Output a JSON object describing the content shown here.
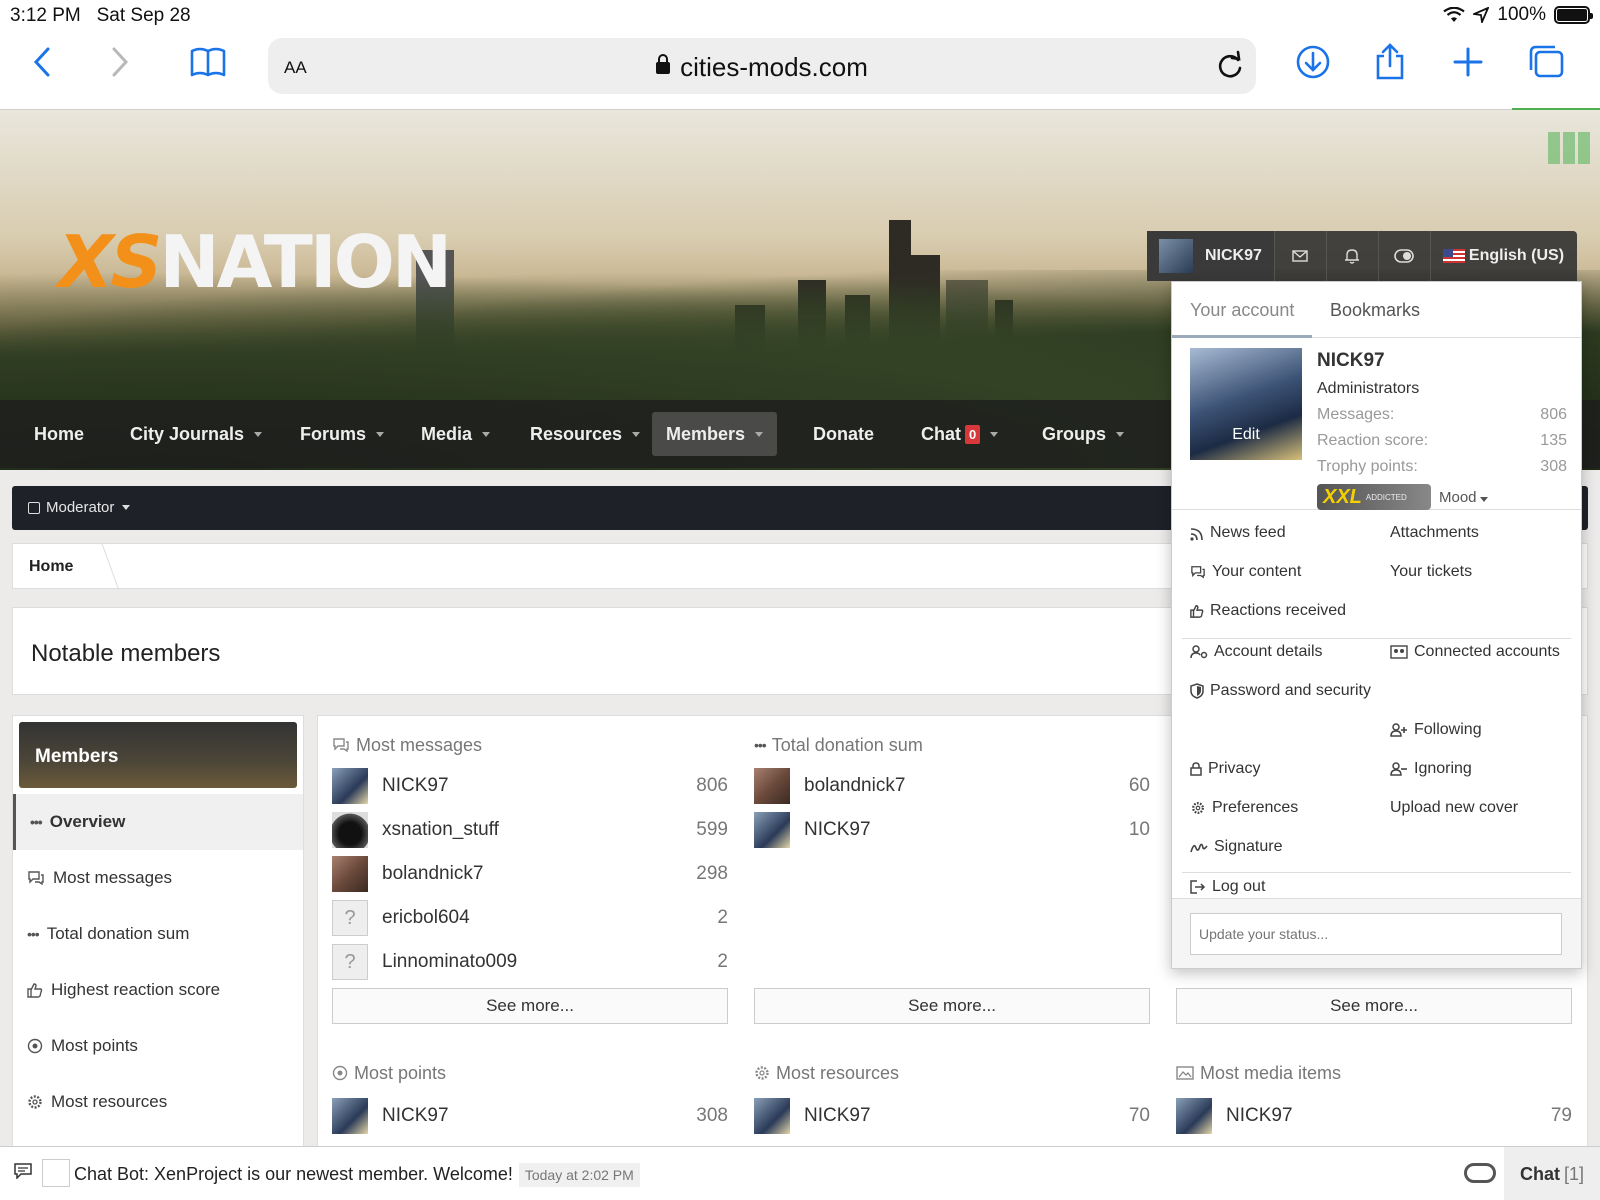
{
  "status": {
    "time": "3:12 PM",
    "date": "Sat Sep 28",
    "battery": "100%"
  },
  "browser": {
    "text_size": "AA",
    "url": "cities-mods.com"
  },
  "site": {
    "logo_xs": "XS",
    "logo_nation": "NATION",
    "nav": [
      {
        "label": "Home"
      },
      {
        "label": "City Journals"
      },
      {
        "label": "Forums"
      },
      {
        "label": "Media"
      },
      {
        "label": "Resources"
      },
      {
        "label": "Members"
      },
      {
        "label": "Donate"
      },
      {
        "label": "Chat",
        "badge": "0"
      },
      {
        "label": "Groups"
      }
    ]
  },
  "userbar": {
    "username": "NICK97",
    "language": "English (US)"
  },
  "moderator": {
    "label": "Moderator"
  },
  "breadcrumb": {
    "home": "Home"
  },
  "page": {
    "title": "Notable members"
  },
  "sidebar": {
    "header": "Members",
    "items": [
      {
        "label": "Overview"
      },
      {
        "label": "Most messages"
      },
      {
        "label": "Total donation sum"
      },
      {
        "label": "Highest reaction score"
      },
      {
        "label": "Most points"
      },
      {
        "label": "Most resources"
      }
    ]
  },
  "lists": {
    "most_messages": {
      "title": "Most messages",
      "rows": [
        {
          "name": "NICK97",
          "value": "806"
        },
        {
          "name": "xsnation_stuff",
          "value": "599"
        },
        {
          "name": "bolandnick7",
          "value": "298"
        },
        {
          "name": "ericbol604",
          "value": "2"
        },
        {
          "name": "Linnominato009",
          "value": "2"
        }
      ],
      "see_more": "See more..."
    },
    "total_donation": {
      "title": "Total donation sum",
      "rows": [
        {
          "name": "bolandnick7",
          "value": "60"
        },
        {
          "name": "NICK97",
          "value": "10"
        }
      ],
      "see_more": "See more..."
    },
    "third": {
      "see_more": "See more..."
    },
    "most_points": {
      "title": "Most points",
      "rows": [
        {
          "name": "NICK97",
          "value": "308"
        }
      ]
    },
    "most_resources": {
      "title": "Most resources",
      "rows": [
        {
          "name": "NICK97",
          "value": "70"
        }
      ]
    },
    "most_media": {
      "title": "Most media items",
      "rows": [
        {
          "name": "NICK97",
          "value": "79"
        }
      ]
    }
  },
  "account_menu": {
    "tab_account": "Your account",
    "tab_bookmarks": "Bookmarks",
    "edit": "Edit",
    "name": "NICK97",
    "group": "Administrators",
    "stats": [
      {
        "label": "Messages:",
        "value": "806"
      },
      {
        "label": "Reaction score:",
        "value": "135"
      },
      {
        "label": "Trophy points:",
        "value": "308"
      }
    ],
    "badge_big": "XXL",
    "badge_small": "ADDICTED",
    "mood": "Mood",
    "links": {
      "news_feed": "News feed",
      "attachments": "Attachments",
      "your_content": "Your content",
      "your_tickets": "Your tickets",
      "reactions": "Reactions received",
      "account_details": "Account details",
      "connected_accounts": "Connected accounts",
      "password_security": "Password and security",
      "following": "Following",
      "privacy": "Privacy",
      "ignoring": "Ignoring",
      "preferences": "Preferences",
      "upload_cover": "Upload new cover",
      "signature": "Signature",
      "log_out": "Log out"
    },
    "status_placeholder": "Update your status..."
  },
  "chat": {
    "message": "Chat Bot: XenProject is our newest member. Welcome!",
    "timestamp": "Today at 2:02 PM",
    "label": "Chat",
    "count": "[1]"
  }
}
